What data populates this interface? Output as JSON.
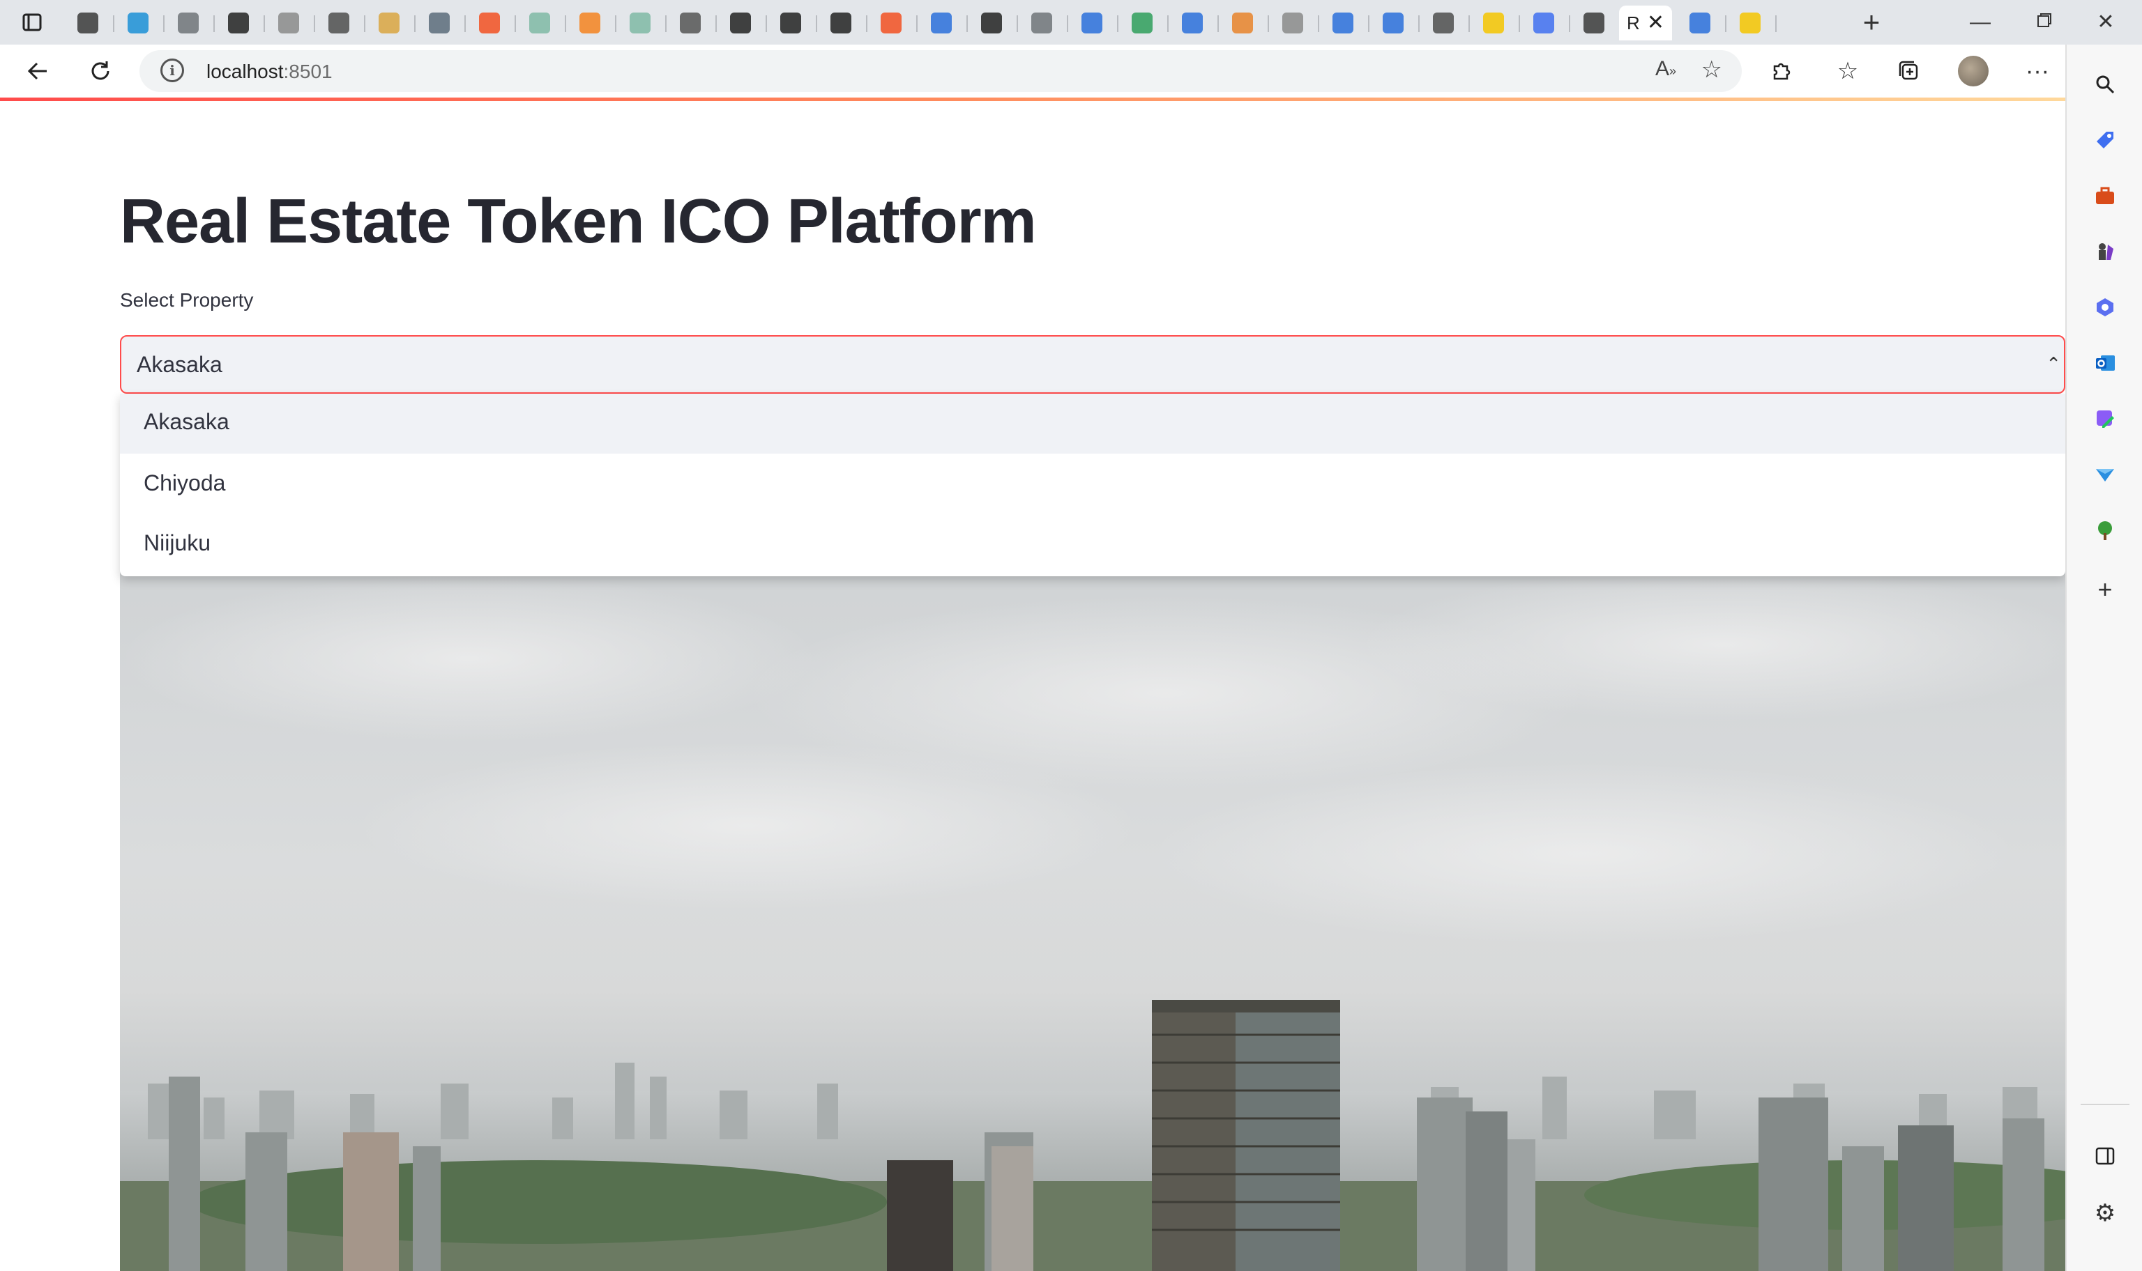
{
  "browser": {
    "active_tab_title": "R",
    "url_host": "localhost",
    "url_port": ":8501",
    "tab_favicon_colors": [
      "#3a3a3a",
      "#1b8fd6",
      "#6e7378",
      "#222222",
      "#8a8a8a",
      "#4d4d4d",
      "#d9a441",
      "#5a6b7a",
      "#f25022",
      "#7fb8a4",
      "#f58220",
      "#7fb8a4",
      "#555555",
      "#222222",
      "#222222",
      "#222222",
      "#f25022",
      "#2a6fdb",
      "#222222",
      "#6e7378",
      "#2a6fdb",
      "#2e9e5b",
      "#2a6fdb",
      "#e8832a",
      "#8a8a8a",
      "#2a6fdb",
      "#2a6fdb",
      "#4d4d4d",
      "#f5c400",
      "#3f6ff0",
      "#3a3a3a",
      "#8a8a8a",
      "#2a6fdb",
      "#f5c400"
    ]
  },
  "sidebar": {
    "icons": [
      "bing-icon",
      "search-icon",
      "shopping-tag-icon",
      "toolbox-icon",
      "chess-icon",
      "copilot-icon",
      "outlook-icon",
      "designer-icon",
      "send-icon",
      "tree-icon",
      "add-icon",
      "split-screen-icon",
      "settings-icon"
    ]
  },
  "app": {
    "title": "Real Estate Token ICO Platform",
    "select_label": "Select Property",
    "selected_value": "Akasaka",
    "options": [
      "Akasaka",
      "Chiyoda",
      "Niijuku"
    ],
    "highlighted_option": "Akasaka"
  },
  "image": {
    "subject": "tokyo-skyline-photo"
  }
}
